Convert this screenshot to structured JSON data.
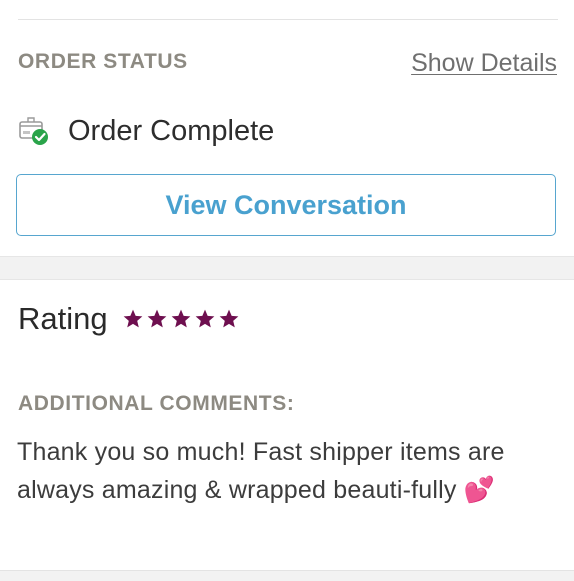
{
  "order_status": {
    "label": "ORDER STATUS",
    "show_details": "Show Details",
    "status_text": "Order Complete",
    "status_icon": "package-check-icon",
    "view_conversation": "View Conversation"
  },
  "rating": {
    "label": "Rating",
    "stars": 5,
    "star_color": "#6e0f4f"
  },
  "comments": {
    "label": "ADDITIONAL COMMENTS:",
    "text": "Thank you so much! Fast shipper items are always amazing & wrapped beauti-fully 💕"
  },
  "colors": {
    "accent": "#49a1cf",
    "check_green": "#2aa44a",
    "muted_label": "#8d8a82"
  }
}
